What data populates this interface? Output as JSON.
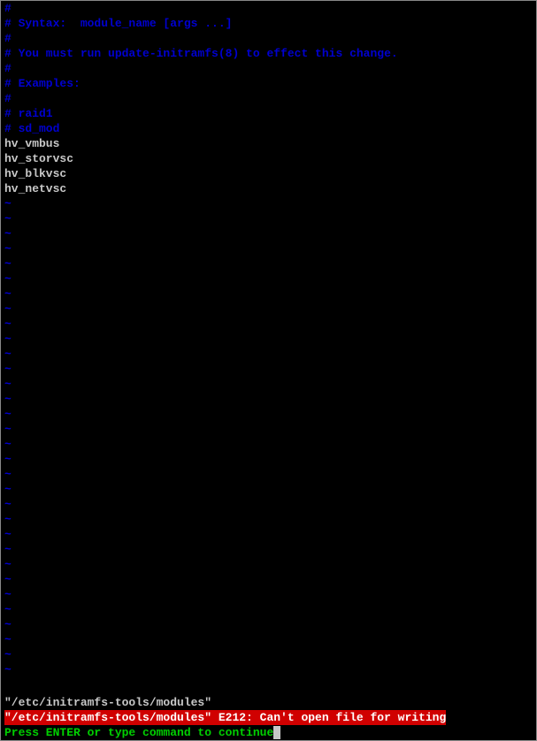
{
  "comments": [
    "#",
    "# Syntax:  module_name [args ...]",
    "#",
    "# You must run update-initramfs(8) to effect this change.",
    "#",
    "# Examples:",
    "#",
    "# raid1",
    "# sd_mod"
  ],
  "content": [
    "hv_vmbus",
    "hv_storvsc",
    "hv_blkvsc",
    "hv_netvsc"
  ],
  "tilde_count": 32,
  "tilde_char": "~",
  "status": {
    "file": "\"/etc/initramfs-tools/modules\"",
    "error": "\"/etc/initramfs-tools/modules\" E212: Can't open file for writing",
    "prompt": "Press ENTER or type command to continue"
  }
}
